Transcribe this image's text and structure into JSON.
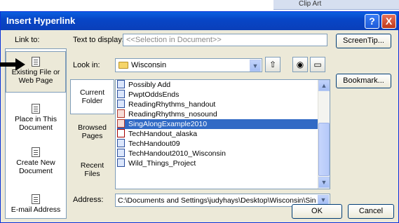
{
  "background": {
    "strip_text": "Clip Art"
  },
  "titlebar": {
    "title": "Insert Hyperlink",
    "help_glyph": "?",
    "close_glyph": "X"
  },
  "link_to": {
    "heading": "Link to:",
    "items": [
      {
        "label_line1": "Existing File or",
        "label_line2": "Web Page",
        "selected": true
      },
      {
        "label_line1": "Place in This",
        "label_line2": "Document",
        "selected": false
      },
      {
        "label_line1": "Create New",
        "label_line2": "Document",
        "selected": false
      },
      {
        "label_line1": "E-mail Address",
        "label_line2": "",
        "selected": false
      }
    ]
  },
  "text_to_display": {
    "label": "Text to display:",
    "value": "<<Selection in Document>>"
  },
  "buttons": {
    "screentip": "ScreenTip...",
    "bookmark": "Bookmark...",
    "ok": "OK",
    "cancel": "Cancel"
  },
  "look_in": {
    "label": "Look in:",
    "value": "Wisconsin"
  },
  "side_tabs": [
    {
      "line1": "Current",
      "line2": "Folder",
      "selected": true
    },
    {
      "line1": "Browsed",
      "line2": "Pages",
      "selected": false
    },
    {
      "line1": "Recent",
      "line2": "Files",
      "selected": false
    }
  ],
  "files": [
    {
      "name": "Possibly Add",
      "icon": "word-doc-icon",
      "selected": false
    },
    {
      "name": "PwptOddsEnds",
      "icon": "word-doc-icon",
      "selected": false
    },
    {
      "name": "ReadingRhythms_handout",
      "icon": "word-doc-icon",
      "selected": false
    },
    {
      "name": "ReadingRhythms_nosound",
      "icon": "powerpoint-icon",
      "selected": false
    },
    {
      "name": "SingAlongExample2010",
      "icon": "powerpoint-icon",
      "selected": true
    },
    {
      "name": "TechHandout_alaska",
      "icon": "pdf-icon",
      "selected": false
    },
    {
      "name": "TechHandout09",
      "icon": "word-doc-icon",
      "selected": false
    },
    {
      "name": "TechHandout2010_Wisconsin",
      "icon": "word-doc-icon",
      "selected": false
    },
    {
      "name": "Wild_Things_Project",
      "icon": "word-doc-icon",
      "selected": false
    }
  ],
  "address": {
    "label": "Address:",
    "value": "C:\\Documents and Settings\\judyhays\\Desktop\\Wisconsin\\SingAl"
  },
  "colors": {
    "title_bar": "#0a4fd0",
    "selection": "#316ac5",
    "dialog_face": "#ece9d8"
  }
}
